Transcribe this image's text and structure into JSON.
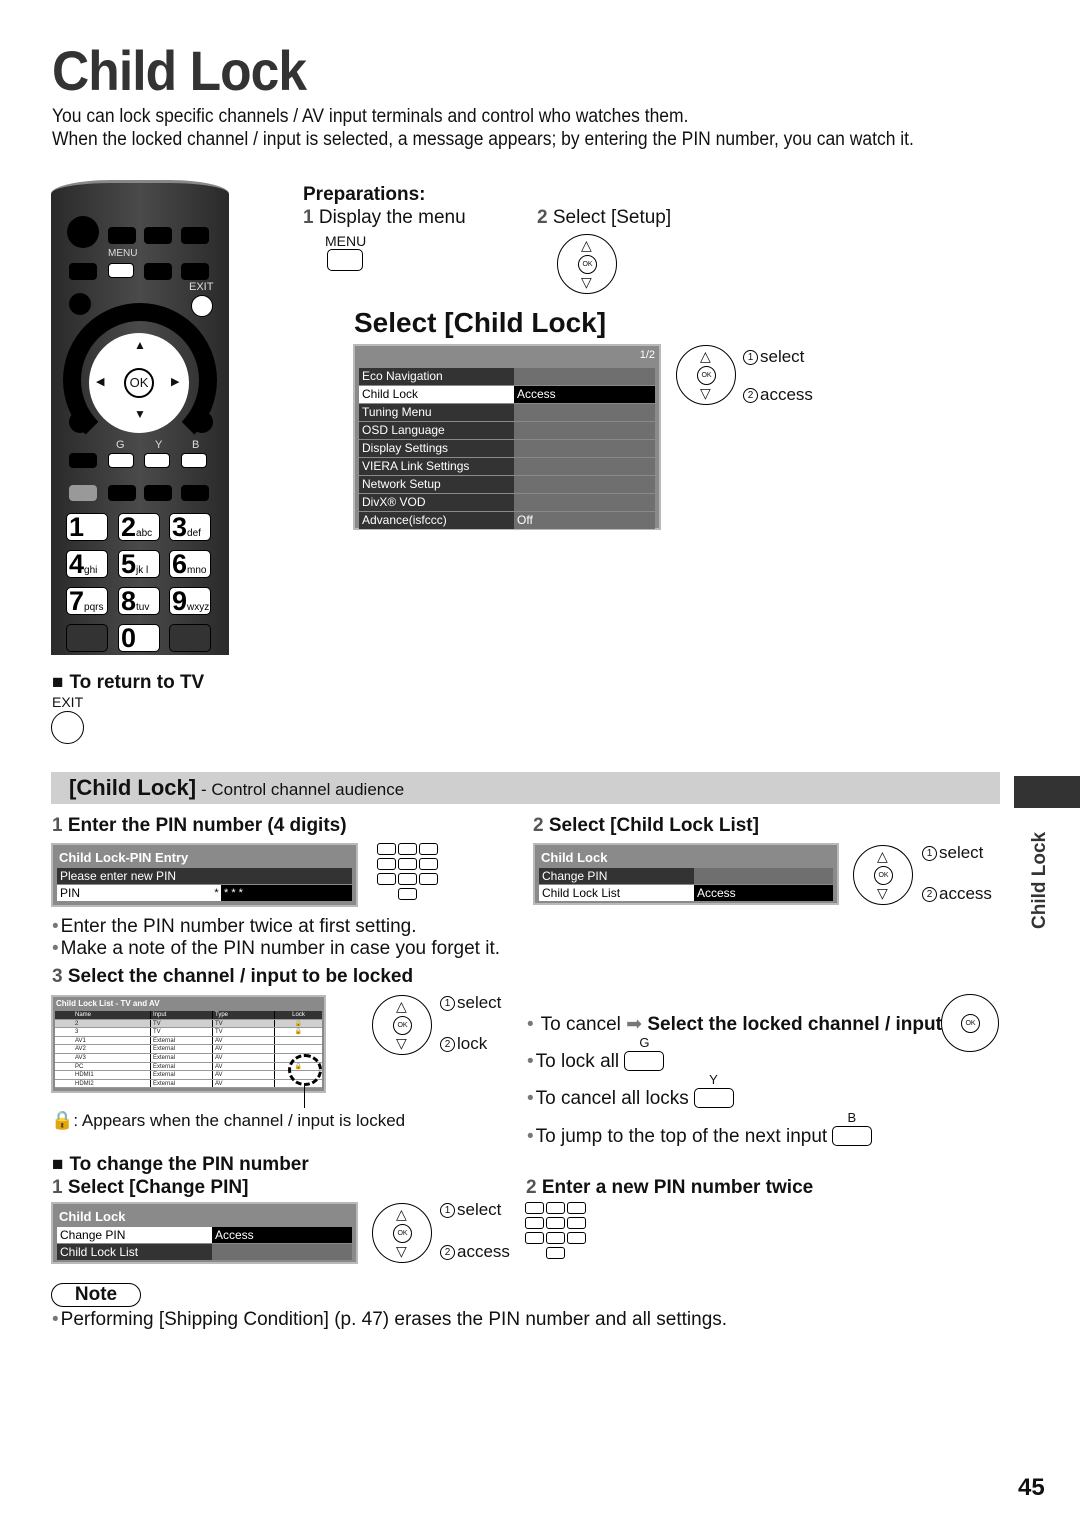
{
  "page": {
    "title": "Child Lock",
    "intro": [
      "You can lock specific channels / AV input terminals and control who watches them.",
      "When the locked channel / input is selected, a message appears; by entering the PIN number, you can watch it."
    ],
    "page_number": "45",
    "side_tab": "Child Lock"
  },
  "remote": {
    "menu_label": "MENU",
    "exit_label": "EXIT",
    "ok_label": "OK",
    "color_labels": [
      "G",
      "Y",
      "B"
    ],
    "keys": [
      {
        "digit": "1",
        "letters": ""
      },
      {
        "digit": "2",
        "letters": "abc"
      },
      {
        "digit": "3",
        "letters": "def"
      },
      {
        "digit": "4",
        "letters": "ghi"
      },
      {
        "digit": "5",
        "letters": "jk l"
      },
      {
        "digit": "6",
        "letters": "mno"
      },
      {
        "digit": "7",
        "letters": "pqrs"
      },
      {
        "digit": "8",
        "letters": "tuv"
      },
      {
        "digit": "9",
        "letters": "wxyz"
      },
      {
        "digit": "0",
        "letters": ""
      }
    ]
  },
  "preparations": {
    "heading": "Preparations:",
    "step1_num": "1",
    "step1": "Display the menu",
    "step1_button": "MENU",
    "step2_num": "2",
    "step2": "Select [Setup]"
  },
  "select_child_lock": {
    "heading": "Select [Child Lock]",
    "page_indicator": "1/2",
    "menu": [
      {
        "label": "Eco Navigation",
        "value": "",
        "selected": false
      },
      {
        "label": "Child Lock",
        "value": "Access",
        "selected": true
      },
      {
        "label": "Tuning Menu",
        "value": "",
        "selected": false
      },
      {
        "label": "OSD Language",
        "value": "",
        "selected": false
      },
      {
        "label": "Display Settings",
        "value": "",
        "selected": false
      },
      {
        "label": "VIERA Link Settings",
        "value": "",
        "selected": false
      },
      {
        "label": "Network Setup",
        "value": "",
        "selected": false
      },
      {
        "label": "DivX® VOD",
        "value": "",
        "selected": false
      },
      {
        "label": "Advance(isfccc)",
        "value": "Off",
        "selected": false
      }
    ]
  },
  "nav": {
    "ok": "OK",
    "n1": "1",
    "n2": "2",
    "select": "select",
    "access": "access",
    "lock": "lock"
  },
  "return_tv": {
    "heading": "To return to TV",
    "button": "EXIT"
  },
  "band": {
    "title": "[Child Lock]",
    "subtitle": " - Control channel audience"
  },
  "step_pin": {
    "num": "1",
    "heading": "Enter the PIN number (4 digits)",
    "osd_title": "Child Lock-PIN Entry",
    "prompt": "Please enter new PIN",
    "field_label": "PIN",
    "field_value_first": "*",
    "field_value_rest": "*  *  *",
    "bullets": [
      "Enter the PIN number twice at first setting.",
      "Make a note of the PIN number in case you forget it."
    ]
  },
  "step_list": {
    "num": "2",
    "heading": "Select [Child Lock List]",
    "osd_title": "Child Lock",
    "rows": [
      {
        "label": "Change PIN",
        "value": "",
        "selected": false
      },
      {
        "label": "Child Lock List",
        "value": "Access",
        "selected": true
      }
    ]
  },
  "step_lock": {
    "num": "3",
    "heading": "Select the channel / input to be locked",
    "list_title": "Child Lock List - TV and AV",
    "columns": [
      "Name",
      "Input",
      "Type",
      "Lock"
    ],
    "rows": [
      {
        "name": "2",
        "input": "TV",
        "type": "TV",
        "locked": true
      },
      {
        "name": "3",
        "input": "TV",
        "type": "TV",
        "locked": true
      },
      {
        "name": "AV1",
        "input": "External",
        "type": "AV",
        "locked": false
      },
      {
        "name": "AV2",
        "input": "External",
        "type": "AV",
        "locked": false
      },
      {
        "name": "AV3",
        "input": "External",
        "type": "AV",
        "locked": false
      },
      {
        "name": "PC",
        "input": "External",
        "type": "AV",
        "locked": true
      },
      {
        "name": "HDMI1",
        "input": "External",
        "type": "AV",
        "locked": false
      },
      {
        "name": "HDMI2",
        "input": "External",
        "type": "AV",
        "locked": false
      }
    ],
    "lock_legend": ": Appears when the channel / input is locked"
  },
  "tips": {
    "cancel_prefix": "To cancel",
    "cancel_action": "Select the locked channel / input",
    "lock_all": "To lock all",
    "lock_all_key": "G",
    "cancel_all": "To cancel all locks",
    "cancel_all_key": "Y",
    "jump": "To jump to the top of the next input",
    "jump_key": "B"
  },
  "change_pin": {
    "heading": "To change the PIN number",
    "step1_num": "1",
    "step1": "Select [Change PIN]",
    "step2_num": "2",
    "step2": "Enter a new PIN number twice",
    "osd_title": "Child Lock",
    "rows": [
      {
        "label": "Change PIN",
        "value": "Access",
        "selected": true
      },
      {
        "label": "Child Lock List",
        "value": "",
        "selected": false
      }
    ]
  },
  "note": {
    "label": "Note",
    "text": "Performing [Shipping Condition] (p. 47) erases the PIN number and all settings."
  }
}
